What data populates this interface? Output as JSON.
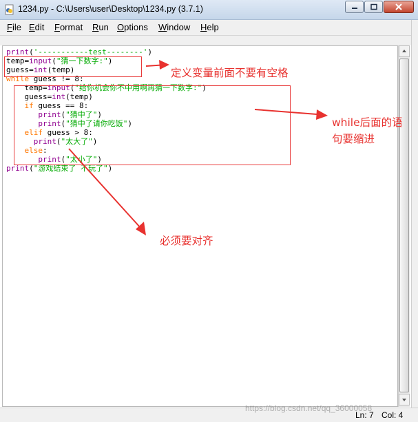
{
  "window": {
    "title": "1234.py - C:\\Users\\user\\Desktop\\1234.py (3.7.1)",
    "icon": "python-file-icon"
  },
  "menu": [
    {
      "mnemonic": "F",
      "rest": "ile"
    },
    {
      "mnemonic": "E",
      "rest": "dit"
    },
    {
      "mnemonic": "F",
      "rest": "ormat"
    },
    {
      "mnemonic": "R",
      "rest": "un"
    },
    {
      "mnemonic": "O",
      "rest": "ptions"
    },
    {
      "mnemonic": "W",
      "rest": "indow"
    },
    {
      "mnemonic": "H",
      "rest": "elp"
    }
  ],
  "code_lines": [
    [
      {
        "t": "print",
        "c": "bi"
      },
      {
        "t": "(",
        "c": ""
      },
      {
        "t": "'-----------test--------'",
        "c": "str"
      },
      {
        "t": ")",
        "c": ""
      }
    ],
    [
      {
        "t": "temp=",
        "c": ""
      },
      {
        "t": "input",
        "c": "bi"
      },
      {
        "t": "(",
        "c": ""
      },
      {
        "t": "\"猜一下数字:\"",
        "c": "str"
      },
      {
        "t": ")",
        "c": ""
      }
    ],
    [
      {
        "t": "guess=",
        "c": ""
      },
      {
        "t": "int",
        "c": "bi"
      },
      {
        "t": "(temp)",
        "c": ""
      }
    ],
    [
      {
        "t": "while",
        "c": "kw"
      },
      {
        "t": " guess != 8:",
        "c": ""
      }
    ],
    [
      {
        "t": "    temp=",
        "c": ""
      },
      {
        "t": "input",
        "c": "bi"
      },
      {
        "t": "(",
        "c": ""
      },
      {
        "t": "\"给你机会你不中用啊再猜一下数字:\"",
        "c": "str"
      },
      {
        "t": ")",
        "c": ""
      }
    ],
    [
      {
        "t": "    guess=",
        "c": ""
      },
      {
        "t": "int",
        "c": "bi"
      },
      {
        "t": "(temp)",
        "c": ""
      }
    ],
    [
      {
        "t": "    ",
        "c": ""
      },
      {
        "t": "if",
        "c": "kw"
      },
      {
        "t": " guess == 8:",
        "c": ""
      }
    ],
    [
      {
        "t": "       ",
        "c": ""
      },
      {
        "t": "print",
        "c": "bi"
      },
      {
        "t": "(",
        "c": ""
      },
      {
        "t": "\"猜中了\"",
        "c": "str"
      },
      {
        "t": ")",
        "c": ""
      }
    ],
    [
      {
        "t": "       ",
        "c": ""
      },
      {
        "t": "print",
        "c": "bi"
      },
      {
        "t": "(",
        "c": ""
      },
      {
        "t": "\"猜中了请你吃饭\"",
        "c": "str"
      },
      {
        "t": ")",
        "c": ""
      }
    ],
    [
      {
        "t": "    ",
        "c": ""
      },
      {
        "t": "elif",
        "c": "kw"
      },
      {
        "t": " guess > 8:",
        "c": ""
      }
    ],
    [
      {
        "t": "      ",
        "c": ""
      },
      {
        "t": "print",
        "c": "bi"
      },
      {
        "t": "(",
        "c": ""
      },
      {
        "t": "\"太大了\"",
        "c": "str"
      },
      {
        "t": ")",
        "c": ""
      }
    ],
    [
      {
        "t": "    ",
        "c": ""
      },
      {
        "t": "else",
        "c": "kw"
      },
      {
        "t": ":",
        "c": ""
      }
    ],
    [
      {
        "t": "       ",
        "c": ""
      },
      {
        "t": "print",
        "c": "bi"
      },
      {
        "t": "(",
        "c": ""
      },
      {
        "t": "\"太小了\"",
        "c": "str"
      },
      {
        "t": ")",
        "c": ""
      }
    ],
    [
      {
        "t": "print",
        "c": "bi"
      },
      {
        "t": "(",
        "c": ""
      },
      {
        "t": "\"游戏结束了 不玩了\"",
        "c": "str"
      },
      {
        "t": ")",
        "c": ""
      }
    ]
  ],
  "annotations": {
    "note1": "定义变量前面不要有空格",
    "note2_line1": "while后面的语",
    "note2_line2": "句要缩进",
    "note3": "必须要对齐",
    "color": "#e8322f"
  },
  "status": {
    "line": "Ln: 7",
    "col": "Col: 4"
  },
  "watermark": "https://blog.csdn.net/qq_36000058",
  "colors": {
    "keyword": "#ff7700",
    "builtin": "#900090",
    "string": "#00aa00"
  }
}
